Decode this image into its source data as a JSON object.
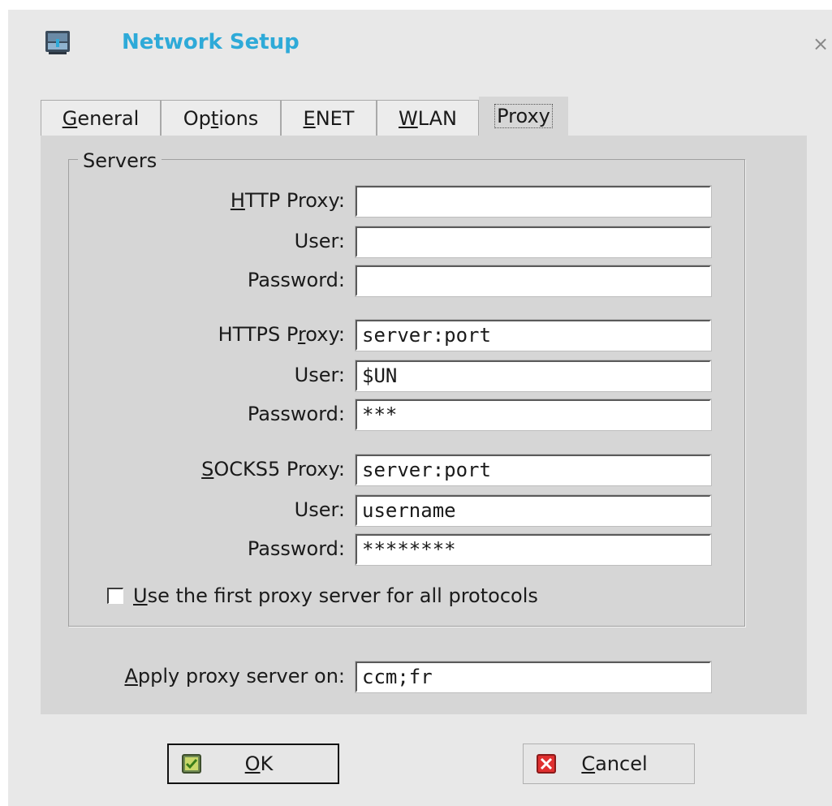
{
  "window": {
    "title": "Network Setup",
    "title_color": "#2eaad8",
    "icon": "network-icon",
    "close_glyph": "×"
  },
  "tabs": [
    {
      "label_pre": "",
      "label_u": "G",
      "label_post": "eneral",
      "active": false
    },
    {
      "label_pre": "Op",
      "label_u": "t",
      "label_post": "ions",
      "active": false
    },
    {
      "label_pre": "",
      "label_u": "E",
      "label_post": "NET",
      "active": false
    },
    {
      "label_pre": "",
      "label_u": "W",
      "label_post": "LAN",
      "active": false
    },
    {
      "label_pre": "Proxy",
      "label_u": "",
      "label_post": "",
      "active": true
    }
  ],
  "servers": {
    "group_title": "Servers",
    "http": {
      "proxy_label_pre": "",
      "proxy_label_u": "H",
      "proxy_label_post": "TTP Proxy:",
      "proxy_value": "",
      "user_label": "User:",
      "user_value": "",
      "password_label": "Password:",
      "password_value": ""
    },
    "https": {
      "proxy_label_pre": "HTTPS P",
      "proxy_label_u": "r",
      "proxy_label_post": "oxy:",
      "proxy_value": "server:port",
      "user_label": "User:",
      "user_value": "$UN",
      "password_label": "Password:",
      "password_value": "***"
    },
    "socks5": {
      "proxy_label_pre": "",
      "proxy_label_u": "S",
      "proxy_label_post": "OCKS5 Proxy:",
      "proxy_value": "server:port",
      "user_label": "User:",
      "user_value": "username",
      "password_label": "Password:",
      "password_value": "********"
    },
    "use_first_checkbox": {
      "label_u": "U",
      "label_post": "se the first proxy server for all protocols",
      "checked": false
    }
  },
  "apply": {
    "label_u": "A",
    "label_post": "pply proxy server on:",
    "value": "ccm;fr"
  },
  "buttons": {
    "ok": {
      "label_u": "O",
      "label_post": "K",
      "icon": "checkmark-icon",
      "icon_color": "#8dc63f"
    },
    "cancel": {
      "label_u": "C",
      "label_post": "ancel",
      "icon": "x-icon",
      "icon_color": "#e03030"
    }
  }
}
